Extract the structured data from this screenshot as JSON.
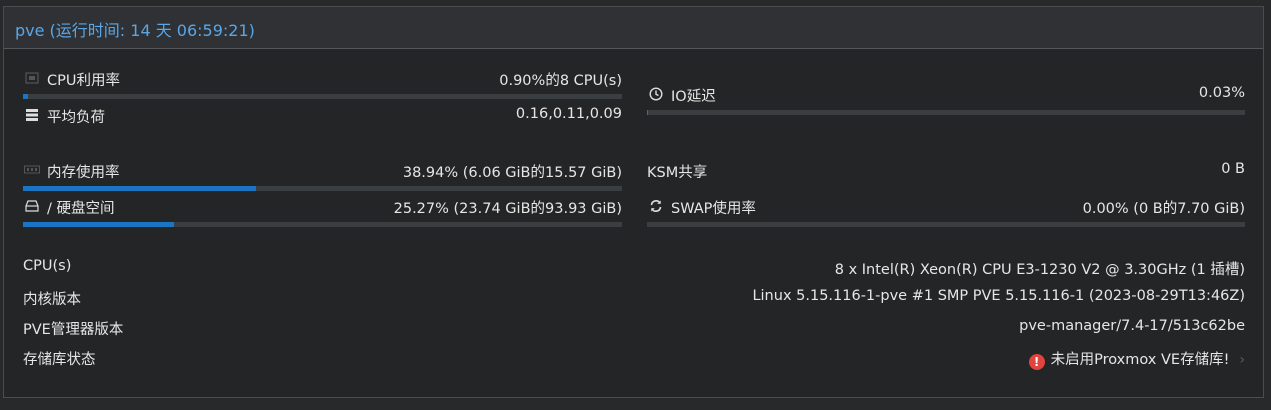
{
  "header": {
    "title": "pve (运行时间: 14 天 06:59:21)"
  },
  "left": {
    "cpu": {
      "label": "CPU利用率",
      "value": "0.90%的8 CPU(s)",
      "icon": "cpu-icon",
      "percent": 0.9
    },
    "load": {
      "label": "平均负荷",
      "value": "0.16,0.11,0.09",
      "icon": "tasks-icon"
    },
    "memory": {
      "label": "内存使用率",
      "value": "38.94% (6.06 GiB的15.57 GiB)",
      "icon": "memory-icon",
      "percent": 38.94
    },
    "disk": {
      "label": "/ 硬盘空间",
      "value": "25.27% (23.74 GiB的93.93 GiB)",
      "icon": "hdd-icon",
      "percent": 25.27
    }
  },
  "right": {
    "io": {
      "label": "IO延迟",
      "value": "0.03%",
      "icon": "clock-icon",
      "percent": 0.03
    },
    "ksm": {
      "label": "KSM共享",
      "value": "0 B"
    },
    "swap": {
      "label": "SWAP使用率",
      "value": "0.00% (0 B的7.70 GiB)",
      "icon": "refresh-icon",
      "percent": 0.0
    }
  },
  "info": {
    "cpus": {
      "label": "CPU(s)",
      "value": "8 x Intel(R) Xeon(R) CPU E3-1230 V2 @ 3.30GHz (1 插槽)"
    },
    "kernel": {
      "label": "内核版本",
      "value": "Linux 5.15.116-1-pve #1 SMP PVE 5.15.116-1 (2023-08-29T13:46Z)"
    },
    "pve": {
      "label": "PVE管理器版本",
      "value": "pve-manager/7.4-17/513c62be"
    },
    "repo": {
      "label": "存储库状态",
      "value": "未启用Proxmox VE存储库!",
      "icon": "warning-icon",
      "chevron": "chevron-right-icon"
    }
  },
  "colors": {
    "accent": "#5aa6e6",
    "bar": "#1a75c4",
    "warning": "#e0443c"
  }
}
